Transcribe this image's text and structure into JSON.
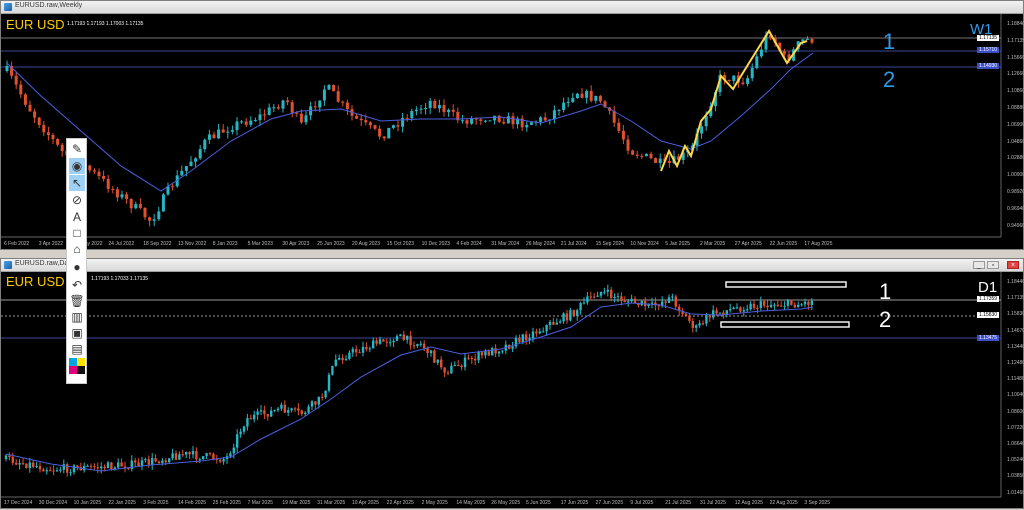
{
  "weekly": {
    "window_title": "EURUSD.raw,Weekly",
    "symbol": "EUR USD",
    "ohlc": "1.17193 1.17193 1.17003 1.17135",
    "timeframe": "W1",
    "zone1": "1",
    "zone2": "2",
    "x_labels": [
      "6 Feb 2022",
      "3 Apr 2022",
      "29 May 2022",
      "24 Jul 2022",
      "18 Sep 2022",
      "13 Nov 2022",
      "8 Jan 2023",
      "5 Mar 2023",
      "30 Apr 2023",
      "25 Jun 2023",
      "20 Aug 2023",
      "15 Oct 2023",
      "10 Dec 2023",
      "4 Feb 2024",
      "31 Mar 2024",
      "26 May 2024",
      "21 Jul 2024",
      "15 Sep 2024",
      "10 Nov 2024",
      "5 Jan 2025",
      "2 Mar 2025",
      "27 Apr 2025",
      "22 Jun 2025",
      "17 Aug 2025"
    ],
    "y_labels": [
      "1.18840",
      "1.17135",
      "1.15660",
      "1.12660",
      "1.10860",
      "1.08880",
      "1.06900",
      "1.04860",
      "1.02880",
      "1.00900",
      "0.98920",
      "0.96940",
      "0.94960"
    ],
    "price_boxes": [
      "1.17135",
      "1.15710",
      "1.14930"
    ]
  },
  "daily": {
    "window_title": "EURUSD.raw,Daily",
    "symbol": "EUR USD",
    "ohlc": "1.17193 1.17033 1.17135",
    "timeframe": "D1",
    "zone1": "1",
    "zone2": "2",
    "x_labels": [
      "17 Dec 2024",
      "30 Dec 2024",
      "10 Jan 2025",
      "22 Jan 2025",
      "3 Feb 2025",
      "14 Feb 2025",
      "25 Feb 2025",
      "7 Mar 2025",
      "19 Mar 2025",
      "31 Mar 2025",
      "10 Apr 2025",
      "22 Apr 2025",
      "2 May 2025",
      "14 May 2025",
      "26 May 2025",
      "5 Jun 2025",
      "17 Jun 2025",
      "27 Jun 2025",
      "9 Jul 2025",
      "21 Jul 2025",
      "31 Jul 2025",
      "12 Aug 2025",
      "22 Aug 2025",
      "3 Sep 2025"
    ],
    "y_labels": [
      "1.18440",
      "1.17135",
      "1.15830",
      "1.14670",
      "1.13440",
      "1.12480",
      "1.11480",
      "1.10040",
      "1.08600",
      "1.07220",
      "1.06640",
      "1.05240",
      "1.03850",
      "1.01460"
    ],
    "price_boxes": [
      "1.17359",
      "1.15830",
      "1.13475"
    ]
  },
  "toolbar": {
    "tools": [
      "pen-icon",
      "eye-icon",
      "cursor-icon",
      "no-draw-icon",
      "text-icon",
      "rectangle-icon",
      "ruler-icon",
      "dot-icon",
      "undo-icon",
      "trash-icon",
      "brush-icon",
      "camera-icon",
      "clipboard-icon",
      "color-palette-icon"
    ]
  },
  "window_buttons": {
    "minimize": "_",
    "restore": "▫",
    "close": "×"
  },
  "colors": {
    "bull": "#27b6c4",
    "bear": "#e0512f",
    "ma": "#4a5fe0",
    "zigzag": "#ffd84a",
    "symbol": "#ffcc00",
    "zone_weekly": "#2e9ae8",
    "zone_daily": "#ffffff"
  }
}
